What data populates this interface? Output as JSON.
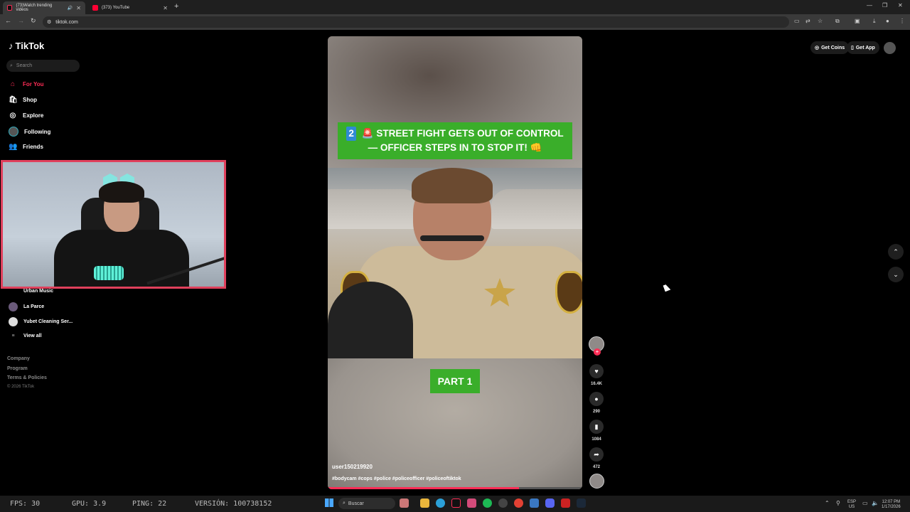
{
  "browser": {
    "tabs": [
      {
        "title": "(73)Watch trending videos"
      },
      {
        "title": "(373) YouTube"
      }
    ],
    "url": "tiktok.com"
  },
  "sidebar": {
    "logo": "TikTok",
    "search_placeholder": "Search",
    "nav": [
      {
        "label": "For You",
        "icon": "home-icon"
      },
      {
        "label": "Shop",
        "icon": "shop-icon"
      },
      {
        "label": "Explore",
        "icon": "compass-icon"
      },
      {
        "label": "Following",
        "icon": "following-avatar"
      },
      {
        "label": "Friends",
        "icon": "friends-icon"
      }
    ],
    "following_list": [
      {
        "label": "Urban Music"
      },
      {
        "label": "La Parce"
      },
      {
        "label": "Yubet Cleaning Ser..."
      }
    ],
    "view_all": "View all",
    "footer": [
      "Company",
      "Program",
      "Terms & Policies"
    ],
    "copyright": "© 2026 TikTok"
  },
  "video": {
    "banner_number": "2",
    "banner_line1": "🚨 STREET FIGHT GETS OUT OF CONTROL",
    "banner_line2": "— OFFICER STEPS IN TO STOP IT! 👊",
    "part_label": "PART 1",
    "username": "user150219920",
    "hashtags": "#bodycam #cops #police #policeofficer #policeoftiktok",
    "progress": 0.75
  },
  "actions": {
    "likes": "16.4K",
    "comments": "290",
    "saves": "1084",
    "shares": "472"
  },
  "topright": {
    "get_coins": "Get Coins",
    "get_app": "Get App"
  },
  "taskbar": {
    "fps": "FPS: 30",
    "gpu": "GPU: 3.9",
    "ping": "PING: 22",
    "version": "VERSIÓN: 100738152",
    "search": "Buscar",
    "lang_top": "ESP",
    "lang_bottom": "US",
    "time": "12:07 PM",
    "date": "1/17/2026"
  }
}
